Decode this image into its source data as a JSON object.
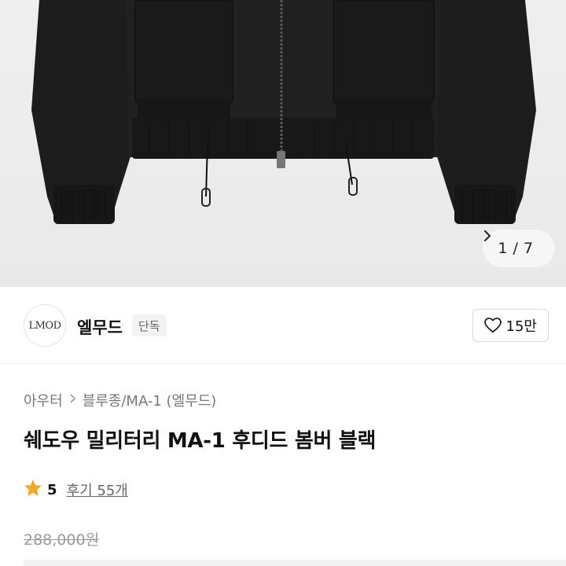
{
  "gallery": {
    "image_alt": "black bomber jacket product photo",
    "current": "1",
    "total": "7",
    "counter_text": "1 / 7",
    "next_icon": "chevron-right-icon"
  },
  "brand": {
    "logo_text": "LMOD",
    "name": "엘무드",
    "badge": "단독",
    "like_icon": "heart-outline-icon",
    "like_count": "15만"
  },
  "breadcrumb": {
    "items": [
      "아우터",
      "블루종/MA-1 (엘무드)"
    ],
    "separator_icon": "chevron-right-icon"
  },
  "product": {
    "title": "쉐도우 밀리터리 MA-1 후디드 봄버 블랙",
    "rating": "5",
    "rating_icon": "star-icon",
    "reviews_label": "후기 55개",
    "original_price": "288,000원"
  },
  "colors": {
    "star": "#f5a623",
    "jacket": "#1b1b1b",
    "background": "#ececec"
  }
}
